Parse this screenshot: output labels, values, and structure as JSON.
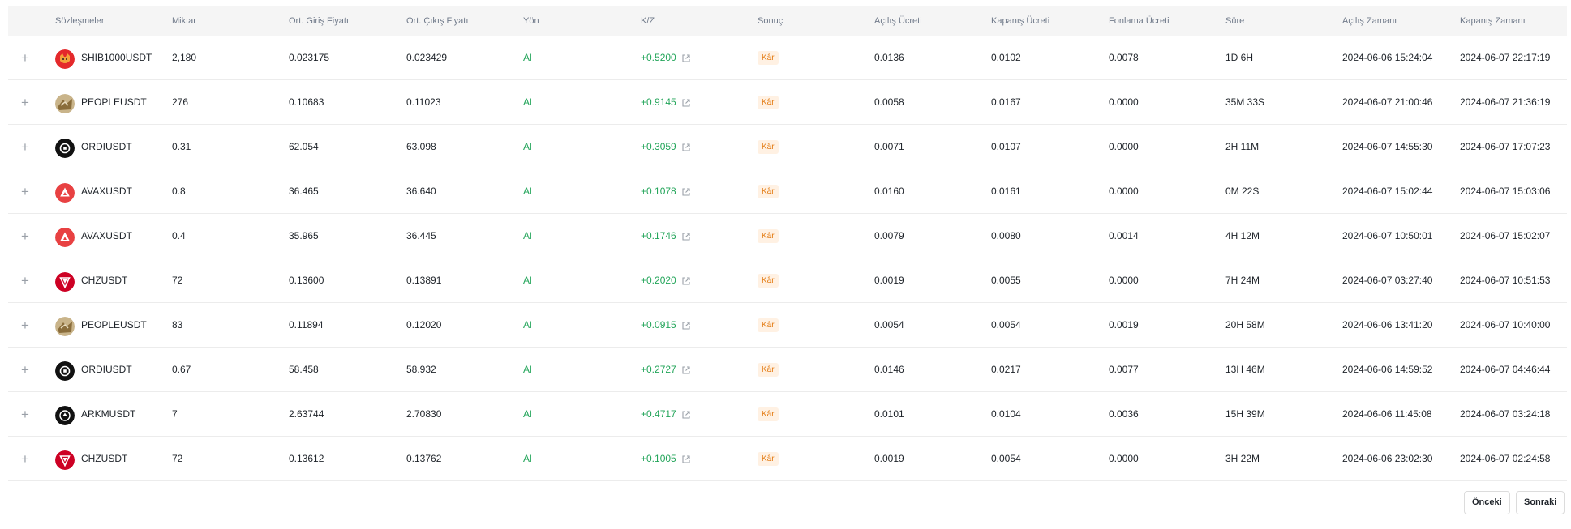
{
  "headers": {
    "contracts": "Sözleşmeler",
    "quantity": "Miktar",
    "avg_entry": "Ort. Giriş Fiyatı",
    "avg_exit": "Ort. Çıkış Fiyatı",
    "side": "Yön",
    "pnl": "K/Z",
    "result": "Sonuç",
    "open_fee": "Açılış Ücreti",
    "close_fee": "Kapanış Ücreti",
    "funding_fee": "Fonlama Ücreti",
    "duration": "Süre",
    "open_time": "Açılış Zamanı",
    "close_time": "Kapanış Zamanı"
  },
  "expand_glyph": "+",
  "rows": [
    {
      "symbol": "SHIB1000USDT",
      "icon": "shib-icon",
      "qty": "2,180",
      "entry": "0.023175",
      "exit": "0.023429",
      "side": "Al",
      "pnl": "+0.5200",
      "result": "Kâr",
      "open_fee": "0.0136",
      "close_fee": "0.0102",
      "funding_fee": "0.0078",
      "duration": "1D 6H",
      "open_time": "2024-06-06 15:24:04",
      "close_time": "2024-06-07 22:17:19"
    },
    {
      "symbol": "PEOPLEUSDT",
      "icon": "people-icon",
      "qty": "276",
      "entry": "0.10683",
      "exit": "0.11023",
      "side": "Al",
      "pnl": "+0.9145",
      "result": "Kâr",
      "open_fee": "0.0058",
      "close_fee": "0.0167",
      "funding_fee": "0.0000",
      "duration": "35M 33S",
      "open_time": "2024-06-07 21:00:46",
      "close_time": "2024-06-07 21:36:19"
    },
    {
      "symbol": "ORDIUSDT",
      "icon": "ordi-icon",
      "qty": "0.31",
      "entry": "62.054",
      "exit": "63.098",
      "side": "Al",
      "pnl": "+0.3059",
      "result": "Kâr",
      "open_fee": "0.0071",
      "close_fee": "0.0107",
      "funding_fee": "0.0000",
      "duration": "2H 11M",
      "open_time": "2024-06-07 14:55:30",
      "close_time": "2024-06-07 17:07:23"
    },
    {
      "symbol": "AVAXUSDT",
      "icon": "avax-icon",
      "qty": "0.8",
      "entry": "36.465",
      "exit": "36.640",
      "side": "Al",
      "pnl": "+0.1078",
      "result": "Kâr",
      "open_fee": "0.0160",
      "close_fee": "0.0161",
      "funding_fee": "0.0000",
      "duration": "0M 22S",
      "open_time": "2024-06-07 15:02:44",
      "close_time": "2024-06-07 15:03:06"
    },
    {
      "symbol": "AVAXUSDT",
      "icon": "avax-icon",
      "qty": "0.4",
      "entry": "35.965",
      "exit": "36.445",
      "side": "Al",
      "pnl": "+0.1746",
      "result": "Kâr",
      "open_fee": "0.0079",
      "close_fee": "0.0080",
      "funding_fee": "0.0014",
      "duration": "4H 12M",
      "open_time": "2024-06-07 10:50:01",
      "close_time": "2024-06-07 15:02:07"
    },
    {
      "symbol": "CHZUSDT",
      "icon": "chz-icon",
      "qty": "72",
      "entry": "0.13600",
      "exit": "0.13891",
      "side": "Al",
      "pnl": "+0.2020",
      "result": "Kâr",
      "open_fee": "0.0019",
      "close_fee": "0.0055",
      "funding_fee": "0.0000",
      "duration": "7H 24M",
      "open_time": "2024-06-07 03:27:40",
      "close_time": "2024-06-07 10:51:53"
    },
    {
      "symbol": "PEOPLEUSDT",
      "icon": "people-icon",
      "qty": "83",
      "entry": "0.11894",
      "exit": "0.12020",
      "side": "Al",
      "pnl": "+0.0915",
      "result": "Kâr",
      "open_fee": "0.0054",
      "close_fee": "0.0054",
      "funding_fee": "0.0019",
      "duration": "20H 58M",
      "open_time": "2024-06-06 13:41:20",
      "close_time": "2024-06-07 10:40:00"
    },
    {
      "symbol": "ORDIUSDT",
      "icon": "ordi-icon",
      "qty": "0.67",
      "entry": "58.458",
      "exit": "58.932",
      "side": "Al",
      "pnl": "+0.2727",
      "result": "Kâr",
      "open_fee": "0.0146",
      "close_fee": "0.0217",
      "funding_fee": "0.0077",
      "duration": "13H 46M",
      "open_time": "2024-06-06 14:59:52",
      "close_time": "2024-06-07 04:46:44"
    },
    {
      "symbol": "ARKMUSDT",
      "icon": "arkm-icon",
      "qty": "7",
      "entry": "2.63744",
      "exit": "2.70830",
      "side": "Al",
      "pnl": "+0.4717",
      "result": "Kâr",
      "open_fee": "0.0101",
      "close_fee": "0.0104",
      "funding_fee": "0.0036",
      "duration": "15H 39M",
      "open_time": "2024-06-06 11:45:08",
      "close_time": "2024-06-07 03:24:18"
    },
    {
      "symbol": "CHZUSDT",
      "icon": "chz-icon",
      "qty": "72",
      "entry": "0.13612",
      "exit": "0.13762",
      "side": "Al",
      "pnl": "+0.1005",
      "result": "Kâr",
      "open_fee": "0.0019",
      "close_fee": "0.0054",
      "funding_fee": "0.0000",
      "duration": "3H 22M",
      "open_time": "2024-06-06 23:02:30",
      "close_time": "2024-06-07 02:24:58"
    }
  ],
  "pagination": {
    "prev_label": "Önceki",
    "next_label": "Sonraki"
  },
  "colors": {
    "positive": "#23a55a",
    "badge_text": "#e37b12",
    "badge_bg": "#fff1e3",
    "header_bg": "#f5f5f5"
  }
}
